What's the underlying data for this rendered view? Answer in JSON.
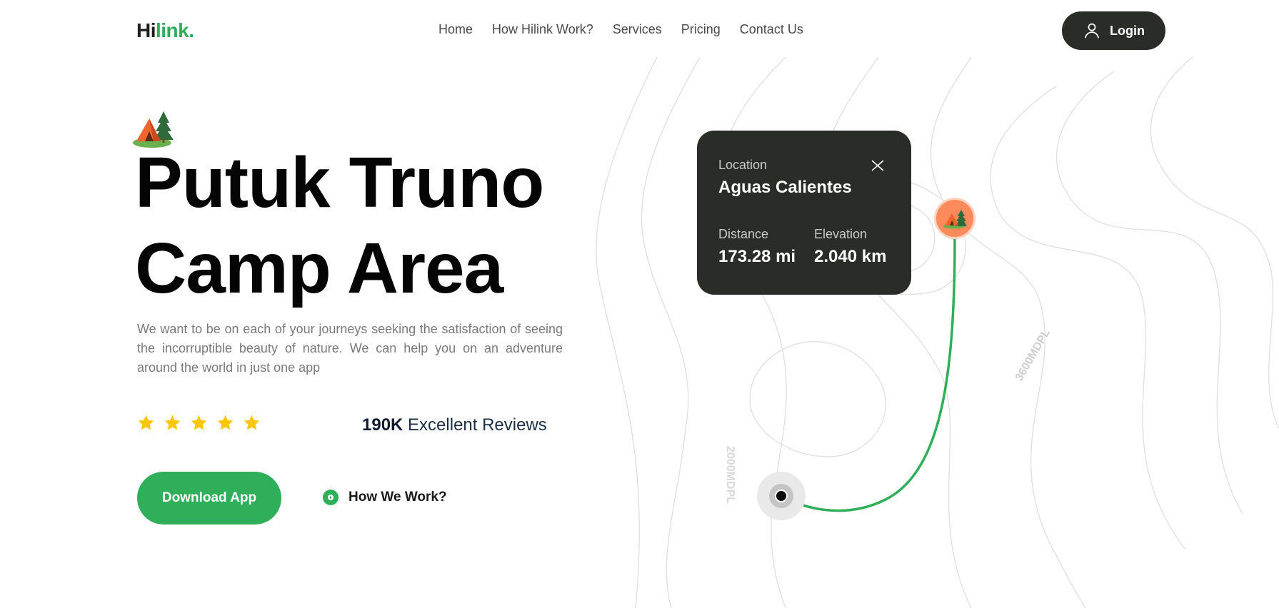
{
  "nav": {
    "logo_main": "Hi",
    "logo_accent": "link.",
    "items": [
      {
        "label": "Home"
      },
      {
        "label": "How Hilink Work?"
      },
      {
        "label": "Services"
      },
      {
        "label": "Pricing"
      },
      {
        "label": "Contact Us"
      }
    ],
    "login_label": "Login",
    "login_icon": "user-icon"
  },
  "hero": {
    "icon": "camp-tent-icon",
    "title_line1": "Putuk Truno",
    "title_line2": "Camp Area",
    "description": "We want to be on each of your journeys seeking the satisfaction of seeing the incorruptible beauty of nature. We can help you on an adventure around the world in just one app",
    "rating_stars": 5,
    "reviews_count": "190K",
    "reviews_label": "Excellent Reviews",
    "download_label": "Download App",
    "how_label": "How We Work?"
  },
  "map": {
    "contour_label_1": "2000MDPL",
    "contour_label_2": "3600MDPL",
    "card": {
      "location_label": "Location",
      "location_value": "Aguas Calientes",
      "distance_label": "Distance",
      "distance_value": "173.28 mi",
      "elevation_label": "Elevation",
      "elevation_value": "2.040 km"
    }
  },
  "colors": {
    "brand_green": "#30af5b",
    "dark": "#292c27",
    "star": "#fec601",
    "pin_orange": "#ff8a5b",
    "contour": "#dcdcdc"
  }
}
